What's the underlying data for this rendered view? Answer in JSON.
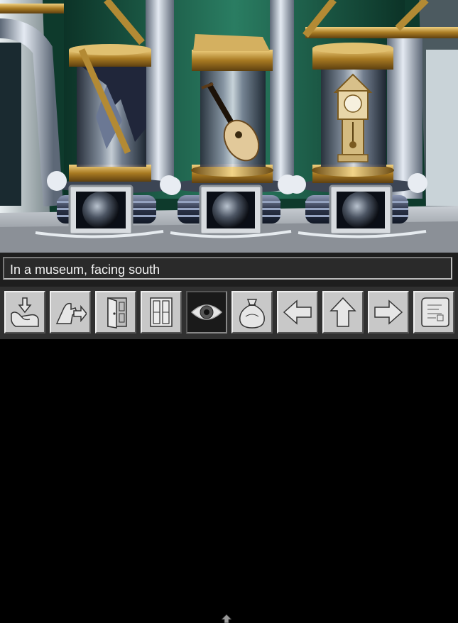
{
  "status": {
    "location_text": "In a museum, facing south"
  },
  "scene": {
    "exhibits": [
      {
        "name": "broken-glass-pillar"
      },
      {
        "name": "lute"
      },
      {
        "name": "grandfather-clock"
      }
    ]
  },
  "toolbar": {
    "buttons": [
      {
        "icon": "take-hand-icon"
      },
      {
        "icon": "use-hand-icon"
      },
      {
        "icon": "open-door-icon"
      },
      {
        "icon": "close-door-icon"
      },
      {
        "icon": "look-eye-icon"
      },
      {
        "icon": "inventory-sack-icon"
      },
      {
        "icon": "arrow-left-icon"
      },
      {
        "icon": "arrow-up-icon"
      },
      {
        "icon": "arrow-right-icon"
      },
      {
        "icon": "map-scroll-icon"
      }
    ]
  },
  "colors": {
    "wall_green": "#1f6a52",
    "brass": "#c9a040",
    "pipe_grey": "#a9b4c2",
    "floor": "#9ea4ab"
  }
}
